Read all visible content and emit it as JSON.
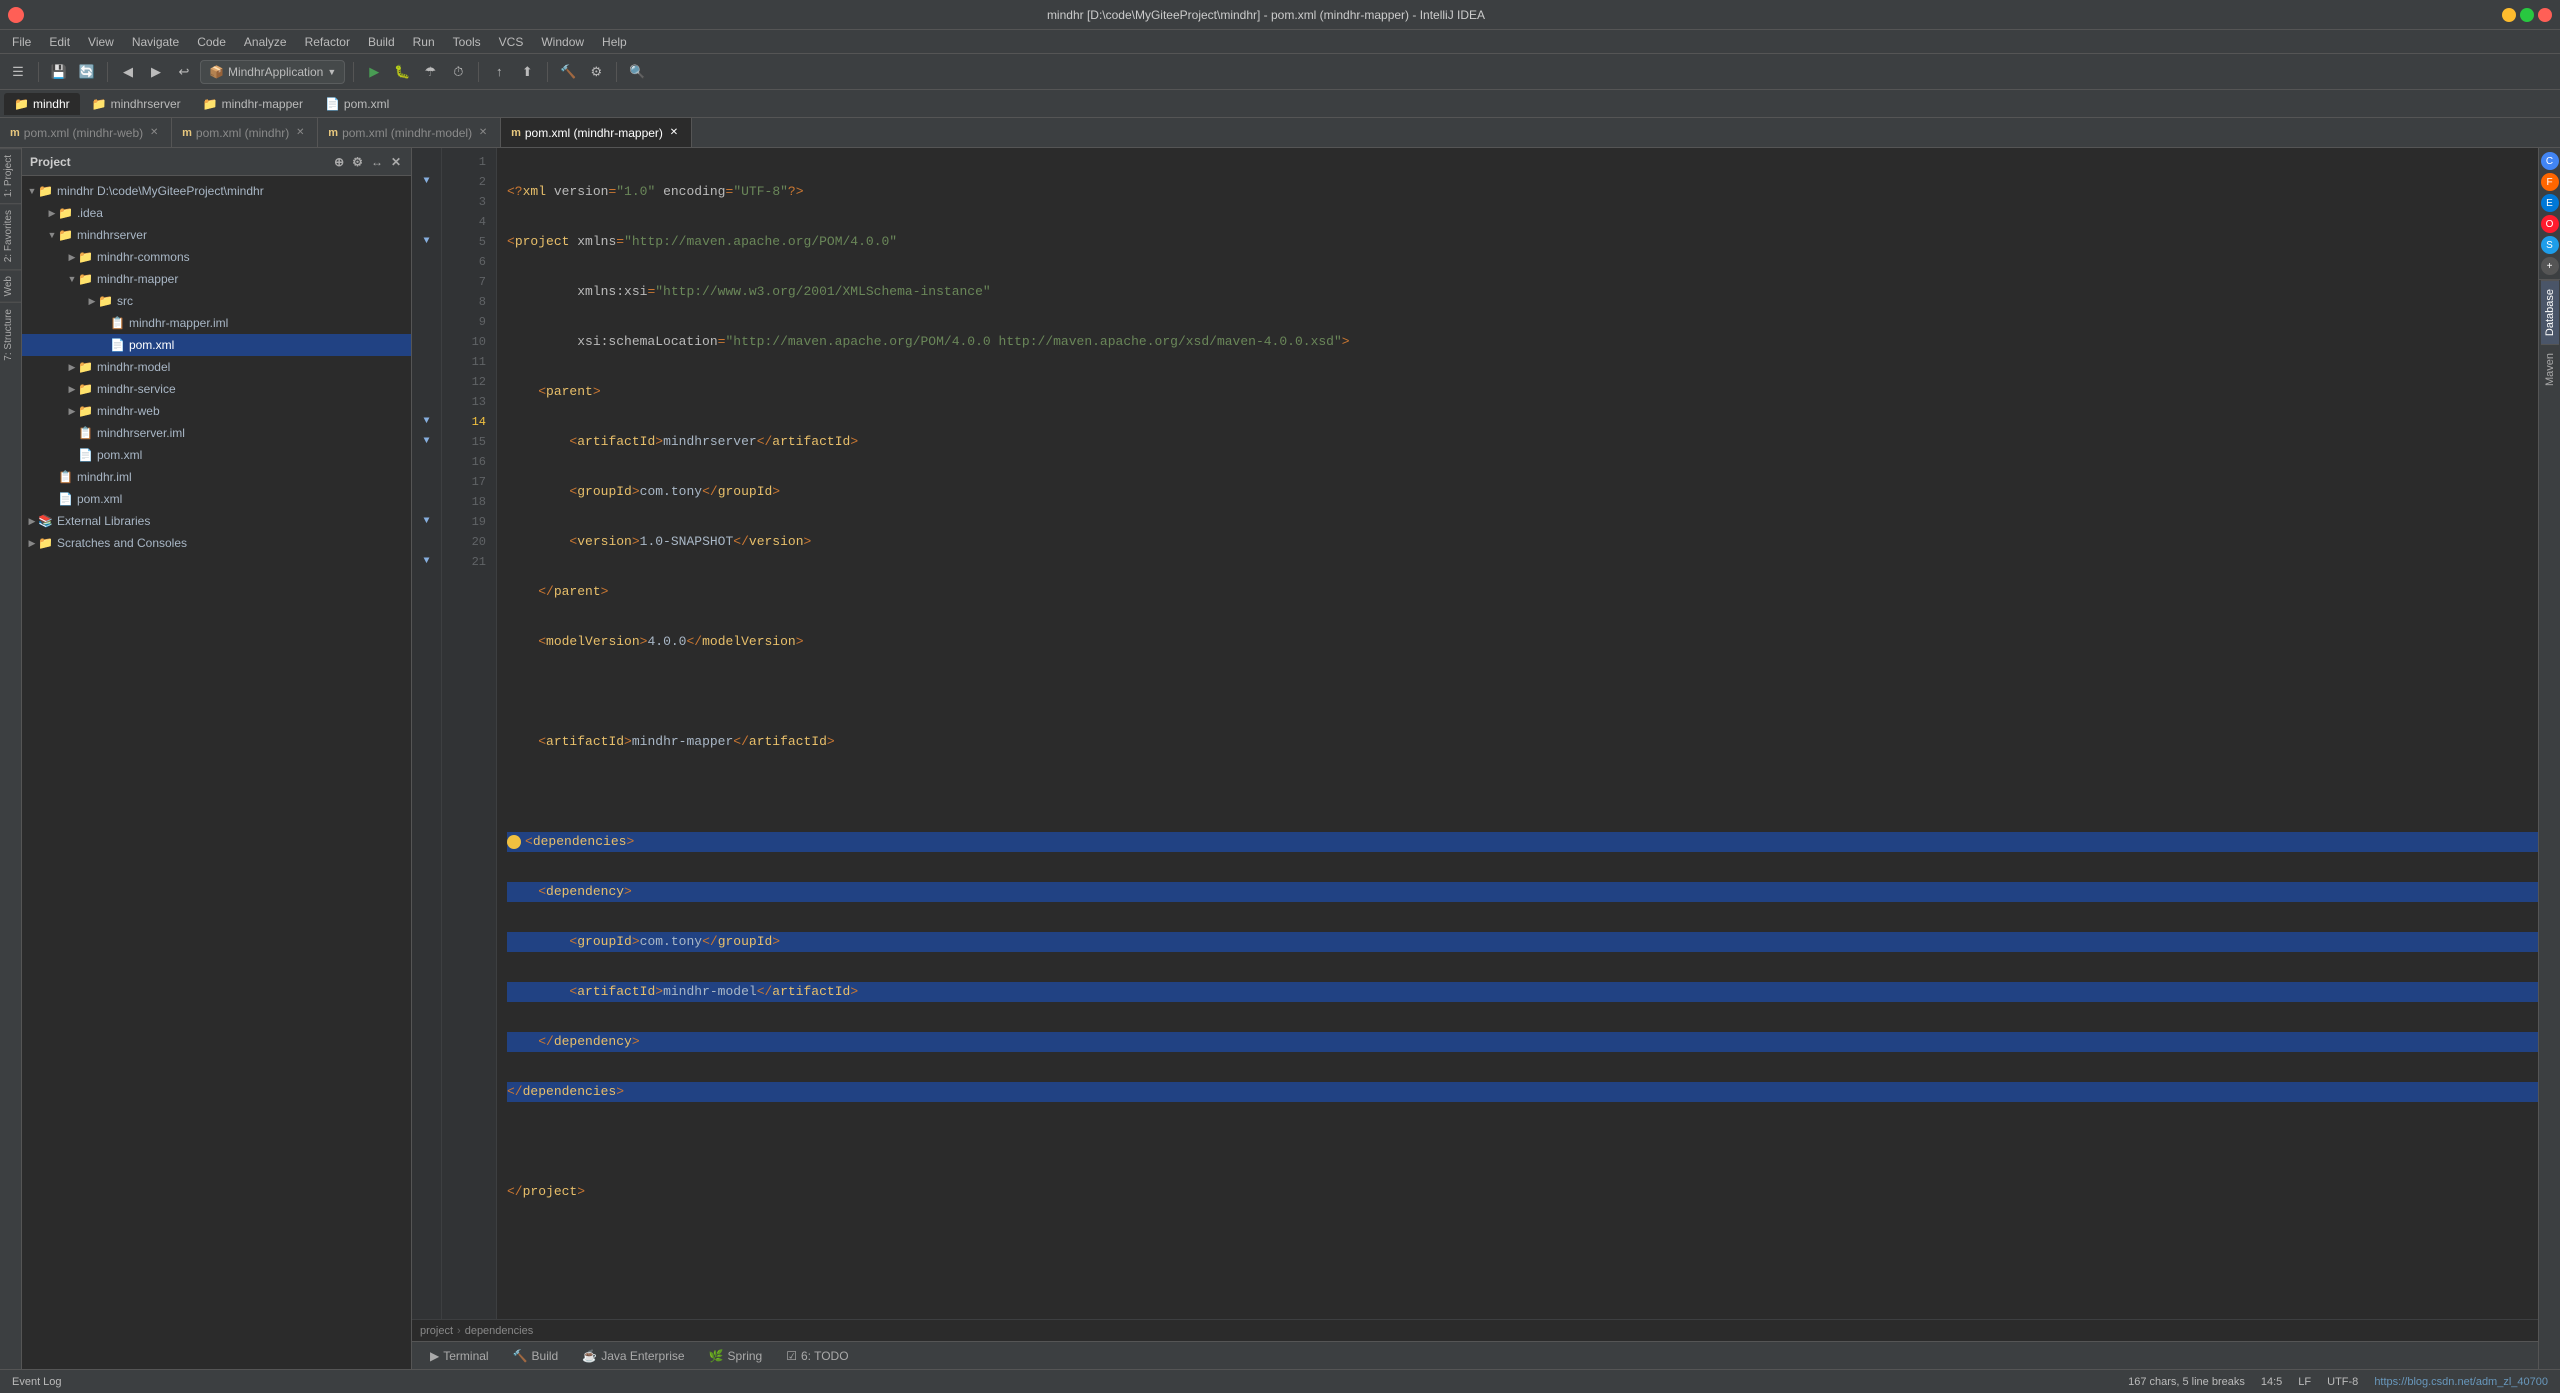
{
  "window": {
    "title": "mindhr [D:\\code\\MyGiteeProject\\mindhr] - pom.xml (mindhr-mapper) - IntelliJ IDEA",
    "minimize_label": "—",
    "maximize_label": "□",
    "close_label": "✕"
  },
  "menubar": {
    "items": [
      "File",
      "Edit",
      "View",
      "Navigate",
      "Code",
      "Analyze",
      "Refactor",
      "Build",
      "Run",
      "Tools",
      "VCS",
      "Window",
      "Help"
    ]
  },
  "toolbar": {
    "run_config": "MindhrApplication",
    "back_label": "◀",
    "forward_label": "▶"
  },
  "project_tabs": {
    "tabs": [
      {
        "label": "mindhr",
        "icon": "📁"
      },
      {
        "label": "mindhrserver",
        "icon": "📁"
      },
      {
        "label": "mindhr-mapper",
        "icon": "📁"
      },
      {
        "label": "pom.xml",
        "icon": "📄"
      }
    ]
  },
  "editor_tabs": [
    {
      "label": "pom.xml (mindhr-web)",
      "active": false,
      "closable": true
    },
    {
      "label": "pom.xml (mindhr)",
      "active": false,
      "closable": true
    },
    {
      "label": "pom.xml (mindhr-model)",
      "active": false,
      "closable": true
    },
    {
      "label": "pom.xml (mindhr-mapper)",
      "active": true,
      "closable": true
    }
  ],
  "project_tree": {
    "header": "Project",
    "items": [
      {
        "id": "mindhr-root",
        "label": "mindhr D:\\code\\MyGiteeProject\\mindhr",
        "indent": 0,
        "type": "root",
        "expanded": true,
        "icon": "📁"
      },
      {
        "id": "idea",
        "label": ".idea",
        "indent": 1,
        "type": "folder",
        "expanded": false,
        "icon": "📁"
      },
      {
        "id": "mindhrserver",
        "label": "mindhrserver",
        "indent": 1,
        "type": "folder",
        "expanded": true,
        "icon": "📁"
      },
      {
        "id": "mindhr-commons",
        "label": "mindhr-commons",
        "indent": 2,
        "type": "folder",
        "expanded": false,
        "icon": "📁"
      },
      {
        "id": "mindhr-mapper",
        "label": "mindhr-mapper",
        "indent": 2,
        "type": "folder",
        "expanded": true,
        "icon": "📁"
      },
      {
        "id": "src",
        "label": "src",
        "indent": 3,
        "type": "folder",
        "expanded": false,
        "icon": "📁"
      },
      {
        "id": "mindhr-mapper-iml",
        "label": "mindhr-mapper.iml",
        "indent": 3,
        "type": "iml",
        "icon": "📋"
      },
      {
        "id": "pom-xml-mapper",
        "label": "pom.xml",
        "indent": 3,
        "type": "xml",
        "selected": true,
        "icon": "📄"
      },
      {
        "id": "mindhr-model",
        "label": "mindhr-model",
        "indent": 2,
        "type": "folder",
        "expanded": false,
        "icon": "📁"
      },
      {
        "id": "mindhr-service",
        "label": "mindhr-service",
        "indent": 2,
        "type": "folder",
        "expanded": false,
        "icon": "📁"
      },
      {
        "id": "mindhr-web",
        "label": "mindhr-web",
        "indent": 2,
        "type": "folder",
        "expanded": false,
        "icon": "📁"
      },
      {
        "id": "mindhrserver-iml",
        "label": "mindhrserver.iml",
        "indent": 2,
        "type": "iml",
        "icon": "📋"
      },
      {
        "id": "pom-xml-root",
        "label": "pom.xml",
        "indent": 2,
        "type": "xml",
        "icon": "📄"
      },
      {
        "id": "mindhr-iml",
        "label": "mindhr.iml",
        "indent": 1,
        "type": "iml",
        "icon": "📋"
      },
      {
        "id": "pom-xml-main",
        "label": "pom.xml",
        "indent": 1,
        "type": "xml",
        "icon": "📄"
      },
      {
        "id": "external-libraries",
        "label": "External Libraries",
        "indent": 0,
        "type": "folder",
        "expanded": false,
        "icon": "📚"
      },
      {
        "id": "scratches",
        "label": "Scratches and Consoles",
        "indent": 0,
        "type": "folder",
        "expanded": false,
        "icon": "📁"
      }
    ]
  },
  "code_lines": [
    {
      "num": 1,
      "content": "<?xml version=\"1.0\" encoding=\"UTF-8\"?>",
      "selected": false
    },
    {
      "num": 2,
      "content": "<project xmlns=\"http://maven.apache.org/POM/4.0.0\"",
      "selected": false
    },
    {
      "num": 3,
      "content": "         xmlns:xsi=\"http://www.w3.org/2001/XMLSchema-instance\"",
      "selected": false
    },
    {
      "num": 4,
      "content": "         xsi:schemaLocation=\"http://maven.apache.org/POM/4.0.0 http://maven.apache.org/xsd/maven-4.0.0.xsd\">",
      "selected": false
    },
    {
      "num": 5,
      "content": "    <parent>",
      "selected": false
    },
    {
      "num": 6,
      "content": "        <artifactId>mindhrserver</artifactId>",
      "selected": false
    },
    {
      "num": 7,
      "content": "        <groupId>com.tony</groupId>",
      "selected": false
    },
    {
      "num": 8,
      "content": "        <version>1.0-SNAPSHOT</version>",
      "selected": false
    },
    {
      "num": 9,
      "content": "    </parent>",
      "selected": false
    },
    {
      "num": 10,
      "content": "    <modelVersion>4.0.0</modelVersion>",
      "selected": false
    },
    {
      "num": 11,
      "content": "",
      "selected": false
    },
    {
      "num": 12,
      "content": "    <artifactId>mindhr-mapper</artifactId>",
      "selected": false
    },
    {
      "num": 13,
      "content": "",
      "selected": false
    },
    {
      "num": 14,
      "content": "<dependencies>",
      "selected": true,
      "has_bulb": true
    },
    {
      "num": 15,
      "content": "    <dependency>",
      "selected": true
    },
    {
      "num": 16,
      "content": "        <groupId>com.tony</groupId>",
      "selected": true
    },
    {
      "num": 17,
      "content": "        <artifactId>mindhr-model</artifactId>",
      "selected": true
    },
    {
      "num": 18,
      "content": "    </dependency>",
      "selected": true
    },
    {
      "num": 19,
      "content": "</dependencies>",
      "selected": true
    },
    {
      "num": 20,
      "content": "",
      "selected": false
    },
    {
      "num": 21,
      "content": "</project>",
      "selected": false
    }
  ],
  "breadcrumb": {
    "items": [
      "project",
      "dependencies"
    ]
  },
  "statusbar": {
    "terminal_label": "Terminal",
    "build_label": "Build",
    "java_enterprise_label": "Java Enterprise",
    "spring_label": "Spring",
    "todo_label": "6: TODO",
    "event_log_label": "Event Log",
    "chars_info": "167 chars, 5 line breaks",
    "position": "14:5",
    "encoding": "UTF-8",
    "line_separator": "LF",
    "url": "https://blog.csdn.net/adm_zl_40700"
  },
  "right_panels": {
    "database_label": "Database",
    "maven_label": "Maven"
  },
  "left_labels": {
    "favorites": "2: Favorites",
    "web": "Web",
    "structure": "7: Structure"
  },
  "browser_icons": {
    "chrome": "C",
    "firefox": "F",
    "edge": "E",
    "opera": "O",
    "safari": "S",
    "other": "+"
  }
}
